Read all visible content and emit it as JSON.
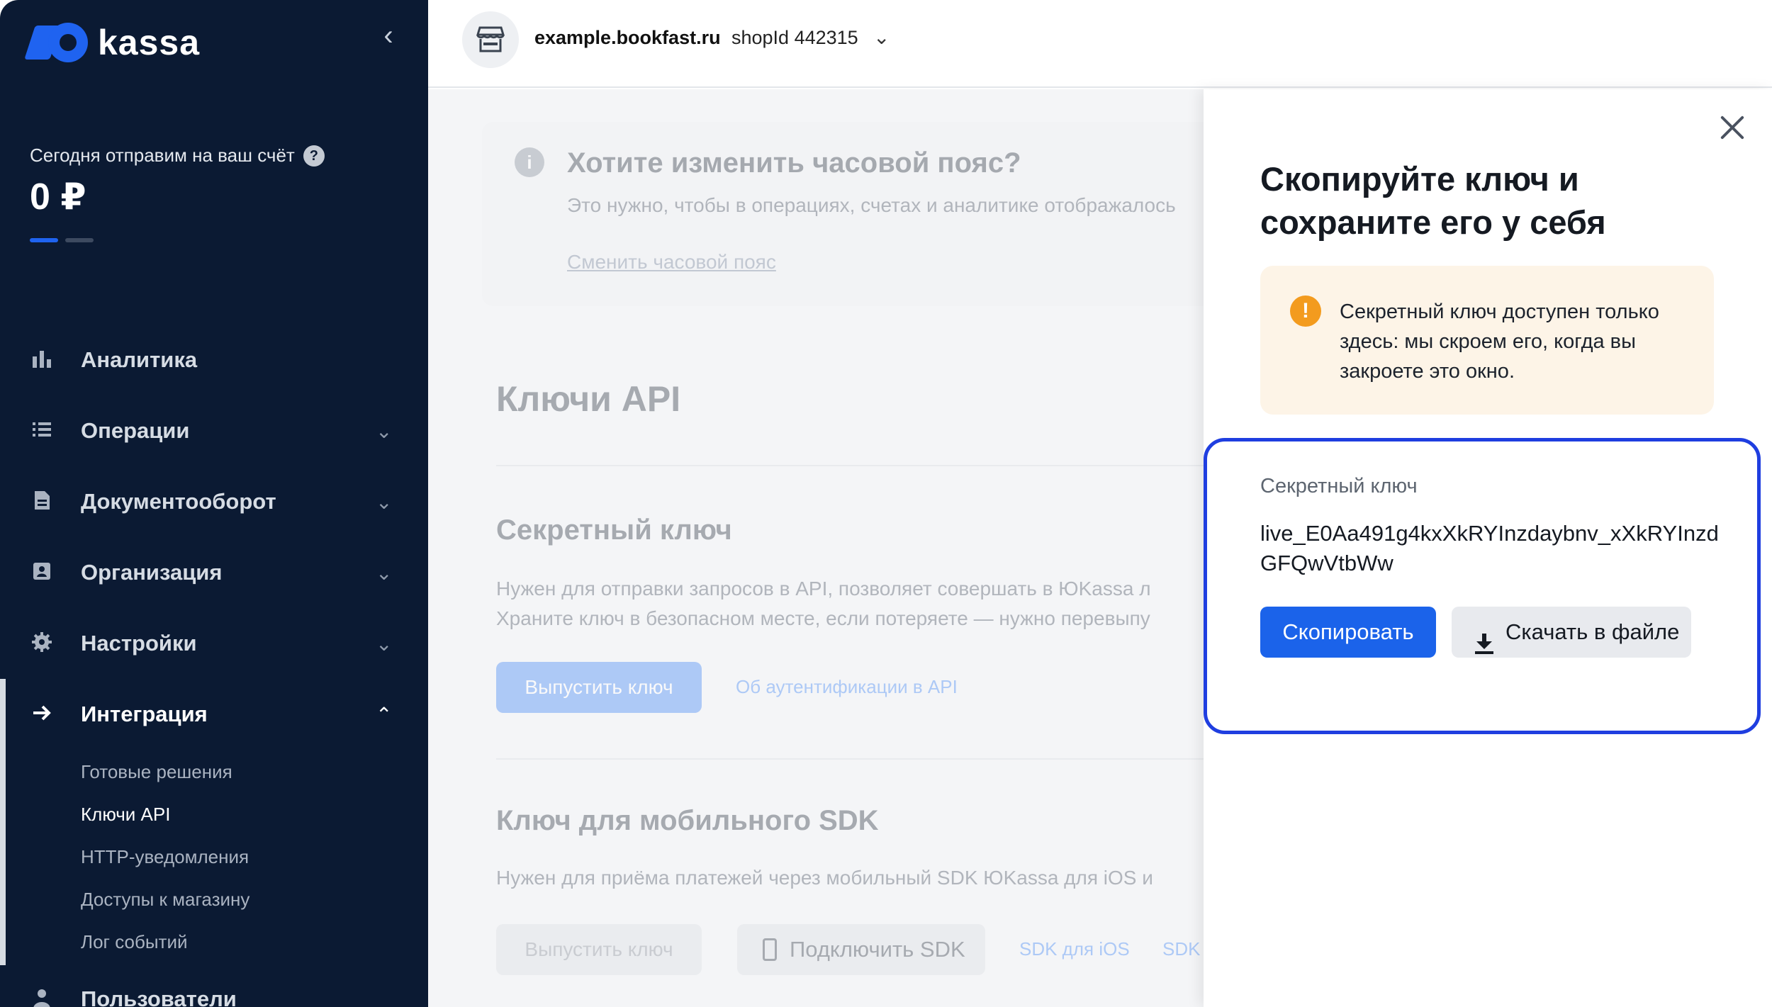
{
  "sidebar": {
    "logo_text": "kassa",
    "balance_label": "Сегодня отправим на ваш счёт",
    "help_glyph": "?",
    "balance_value": "0 ₽",
    "nav": [
      {
        "label": "Аналитика",
        "icon": "bar-chart-icon"
      },
      {
        "label": "Операции",
        "icon": "list-icon"
      },
      {
        "label": "Документооборот",
        "icon": "document-icon"
      },
      {
        "label": "Организация",
        "icon": "contact-card-icon"
      },
      {
        "label": "Настройки",
        "icon": "gear-icon"
      },
      {
        "label": "Интеграция",
        "icon": "arrow-right-icon"
      },
      {
        "label": "Пользователи",
        "icon": "user-icon"
      }
    ],
    "integration_items": [
      "Готовые решения",
      "Ключи API",
      "HTTP-уведомления",
      "Доступы к магазину",
      "Лог событий"
    ],
    "current_item": "Ключи API"
  },
  "topbar": {
    "shop_domain": "example.bookfast.ru",
    "shop_id": "shopId 442315"
  },
  "main": {
    "timezone_title": "Хотите изменить часовой пояс?",
    "timezone_text": "Это нужно, чтобы в операциях, счетах и аналитике отображалось",
    "timezone_link": "Сменить часовой пояс",
    "page_title": "Ключи API",
    "secret_title": "Секретный ключ",
    "secret_text_1": "Нужен для отправки запросов в API, позволяет совершать в ЮKassa л",
    "secret_text_2": "Храните ключ в безопасном месте, если потеряете — нужно перевыпу",
    "issue_button": "Выпустить ключ",
    "auth_link": "Об аутентификации в API",
    "sdk_title": "Ключ для мобильного SDK",
    "sdk_text": "Нужен для приёма платежей через мобильный SDK ЮKassa для iOS и",
    "sdk_issue_button": "Выпустить ключ",
    "sdk_connect_button": "Подключить SDK",
    "sdk_ios_link": "SDK для iOS",
    "sdk_android_link": "SDK"
  },
  "drawer": {
    "title": "Скопируйте ключ и сохраните его у себя",
    "warning_glyph": "!",
    "warning": "Секретный ключ доступен только здесь: мы скроем его, когда вы закроете это окно.",
    "key_label": "Секретный ключ",
    "key_value": "live_E0Aa491g4kxXkRYInzdaybnv_xXkRYInzdGFQwVtbWw",
    "copy_button": "Скопировать",
    "download_button": "Скачать в файле"
  },
  "colors": {
    "sidebar_bg": "#0b1a33",
    "brand_blue": "#1f63f0",
    "primary_button": "#1b63ea",
    "warning_orange": "#f39b1e",
    "warning_bg": "#fdf4e7",
    "highlight_border": "#1f3ee0"
  }
}
